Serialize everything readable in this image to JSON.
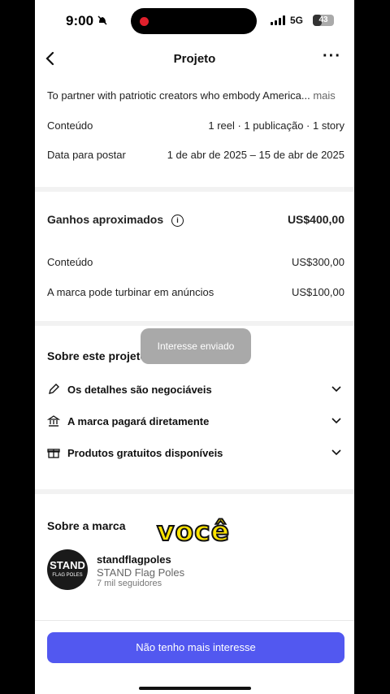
{
  "status": {
    "time": "9:00",
    "network": "5G",
    "battery": "43",
    "battery_level": 0.43
  },
  "nav": {
    "title": "Projeto"
  },
  "project": {
    "description": "To partner with patriotic creators who embody America...",
    "more_label": "mais",
    "content_label": "Conteúdo",
    "content_value": "1 reel · 1 publicação · 1 story",
    "date_label": "Data para postar",
    "date_value": "1 de abr de 2025 – 15 de abr de 2025"
  },
  "earnings": {
    "title": "Ganhos aproximados",
    "total": "US$400,00",
    "content_label": "Conteúdo",
    "content_value": "US$300,00",
    "boost_label": "A marca pode turbinar em anúncios",
    "boost_value": "US$100,00"
  },
  "about_project": {
    "title": "Sobre este projeto",
    "items": [
      {
        "label": "Os detalhes são negociáveis",
        "icon": "pencil-icon"
      },
      {
        "label": "A marca pagará diretamente",
        "icon": "bank-icon"
      },
      {
        "label": "Produtos gratuitos disponíveis",
        "icon": "gift-icon"
      }
    ]
  },
  "toast": {
    "text": "Interesse enviado"
  },
  "brand": {
    "title": "Sobre a marca",
    "logo_text": "STAND",
    "username": "standflagpoles",
    "display_name": "STAND Flag Poles",
    "followers": "7 mil seguidores"
  },
  "caption": {
    "text": "você"
  },
  "cta": {
    "label": "Não tenho mais interesse"
  }
}
